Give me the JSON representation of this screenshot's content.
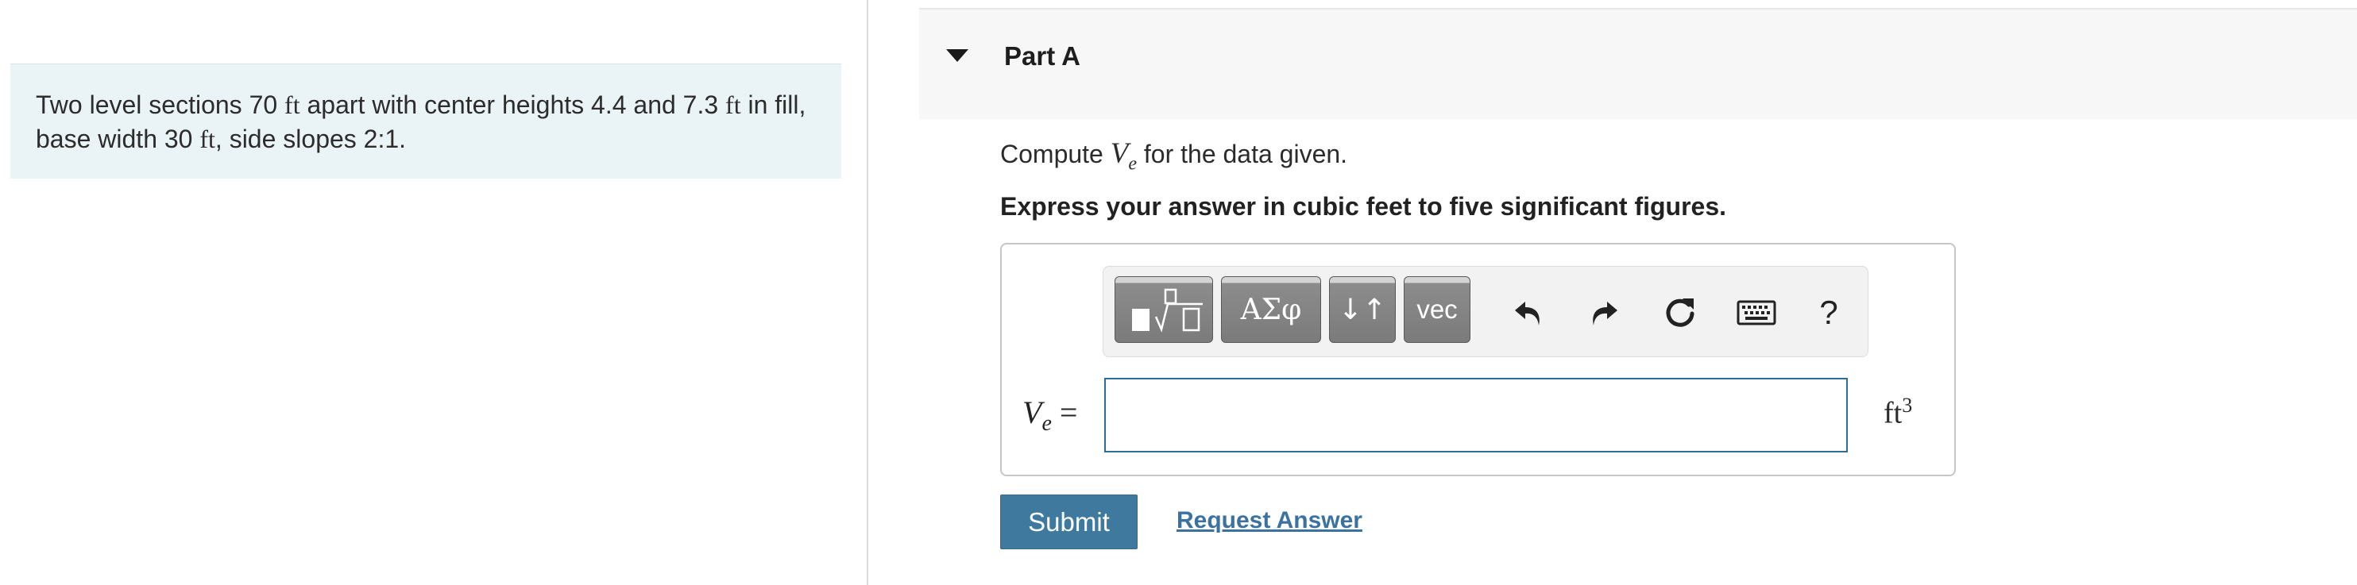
{
  "problem": {
    "text_1": "Two level sections 70 ",
    "unit_1": "ft",
    "text_2": " apart with center heights 4.4 and 7.3 ",
    "unit_2": "ft",
    "text_3": " in fill, base width 30 ",
    "unit_3": "ft",
    "text_4": ", side slopes 2:1."
  },
  "part": {
    "title": "Part A"
  },
  "question": {
    "prefix": "Compute ",
    "var": "V",
    "var_sub": "e",
    "suffix": " for the data given."
  },
  "instruction": "Express your answer in cubic feet to five significant figures.",
  "toolbar": {
    "greek_label": "ΑΣφ",
    "arrows_label": "↓↑",
    "vec_label": "vec",
    "help_label": "?",
    "icons": [
      "templates-icon",
      "undo-icon",
      "redo-icon",
      "reset-icon",
      "keyboard-icon",
      "help-icon"
    ]
  },
  "answer": {
    "label_var": "V",
    "label_sub": "e",
    "label_eq": " =",
    "value": "",
    "unit": "ft",
    "unit_exp": "3"
  },
  "actions": {
    "submit_label": "Submit",
    "request_label": "Request Answer"
  },
  "colors": {
    "problem_bg": "#eaf4f6",
    "header_bg": "#f7f7f7",
    "submit_bg": "#3f7a9e",
    "input_border": "#2b6d9d",
    "link": "#3b72a0"
  }
}
